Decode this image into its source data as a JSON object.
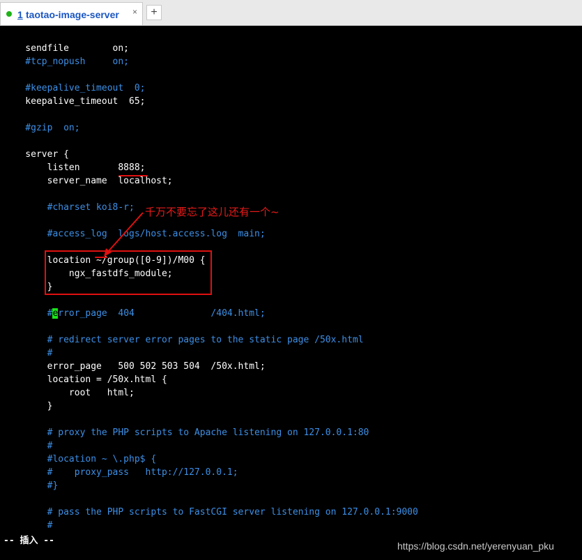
{
  "tab": {
    "number": "1",
    "title": "taotao-image-server",
    "close_glyph": "×",
    "new_tab_glyph": "+",
    "status_color": "#1fb317"
  },
  "lines": [
    {
      "text": "    sendfile        on;",
      "style": "w"
    },
    {
      "text": "    #tcp_nopush     on;",
      "style": "c"
    },
    {
      "text": "",
      "style": "w"
    },
    {
      "text": "    #keepalive_timeout  0;",
      "style": "c"
    },
    {
      "text": "    keepalive_timeout  65;",
      "style": "w"
    },
    {
      "text": "",
      "style": "w"
    },
    {
      "text": "    #gzip  on;",
      "style": "c"
    },
    {
      "text": "",
      "style": "w"
    },
    {
      "text": "    server {",
      "style": "w"
    },
    {
      "text": "        listen       8888;",
      "style": "w"
    },
    {
      "text": "        server_name  localhost;",
      "style": "w"
    },
    {
      "text": "",
      "style": "w"
    },
    {
      "text": "        #charset koi8-r;",
      "style": "c"
    },
    {
      "text": "",
      "style": "w"
    },
    {
      "text": "        #access_log  logs/host.access.log  main;",
      "style": "c"
    },
    {
      "text": "",
      "style": "w"
    },
    {
      "text": "        location ~/group([0-9])/M00 {",
      "style": "w"
    },
    {
      "text": "            ngx_fastdfs_module;",
      "style": "w"
    },
    {
      "text": "        }",
      "style": "w"
    },
    {
      "text": "",
      "style": "w"
    },
    {
      "text": "",
      "style": "c",
      "cursor_line": true
    },
    {
      "text": "",
      "style": "w"
    },
    {
      "text": "        # redirect server error pages to the static page /50x.html",
      "style": "c"
    },
    {
      "text": "        #",
      "style": "c"
    },
    {
      "text": "        error_page   500 502 503 504  /50x.html;",
      "style": "w"
    },
    {
      "text": "        location = /50x.html {",
      "style": "w"
    },
    {
      "text": "            root   html;",
      "style": "w"
    },
    {
      "text": "        }",
      "style": "w"
    },
    {
      "text": "",
      "style": "w"
    },
    {
      "text": "        # proxy the PHP scripts to Apache listening on 127.0.0.1:80",
      "style": "c"
    },
    {
      "text": "        #",
      "style": "c"
    },
    {
      "text": "        #location ~ \\.php$ {",
      "style": "c"
    },
    {
      "text": "        #    proxy_pass   http://127.0.0.1;",
      "style": "c"
    },
    {
      "text": "        #}",
      "style": "c"
    },
    {
      "text": "",
      "style": "w"
    },
    {
      "text": "        # pass the PHP scripts to FastCGI server listening on 127.0.0.1:9000",
      "style": "c"
    },
    {
      "text": "        #",
      "style": "c"
    }
  ],
  "cursor_line": {
    "before": "        #",
    "cursor_char": "e",
    "after": "rror_page  404              /404.html;"
  },
  "status_line": "-- 插入 --",
  "annotation": "千万不要忘了这儿还有一个~",
  "watermark": "https://blog.csdn.net/yerenyuan_pku",
  "colors": {
    "background": "#000000",
    "text": "#ffffff",
    "comment": "#3d8fe6",
    "cursor": "#19e619",
    "annotation": "#e81a1a"
  }
}
